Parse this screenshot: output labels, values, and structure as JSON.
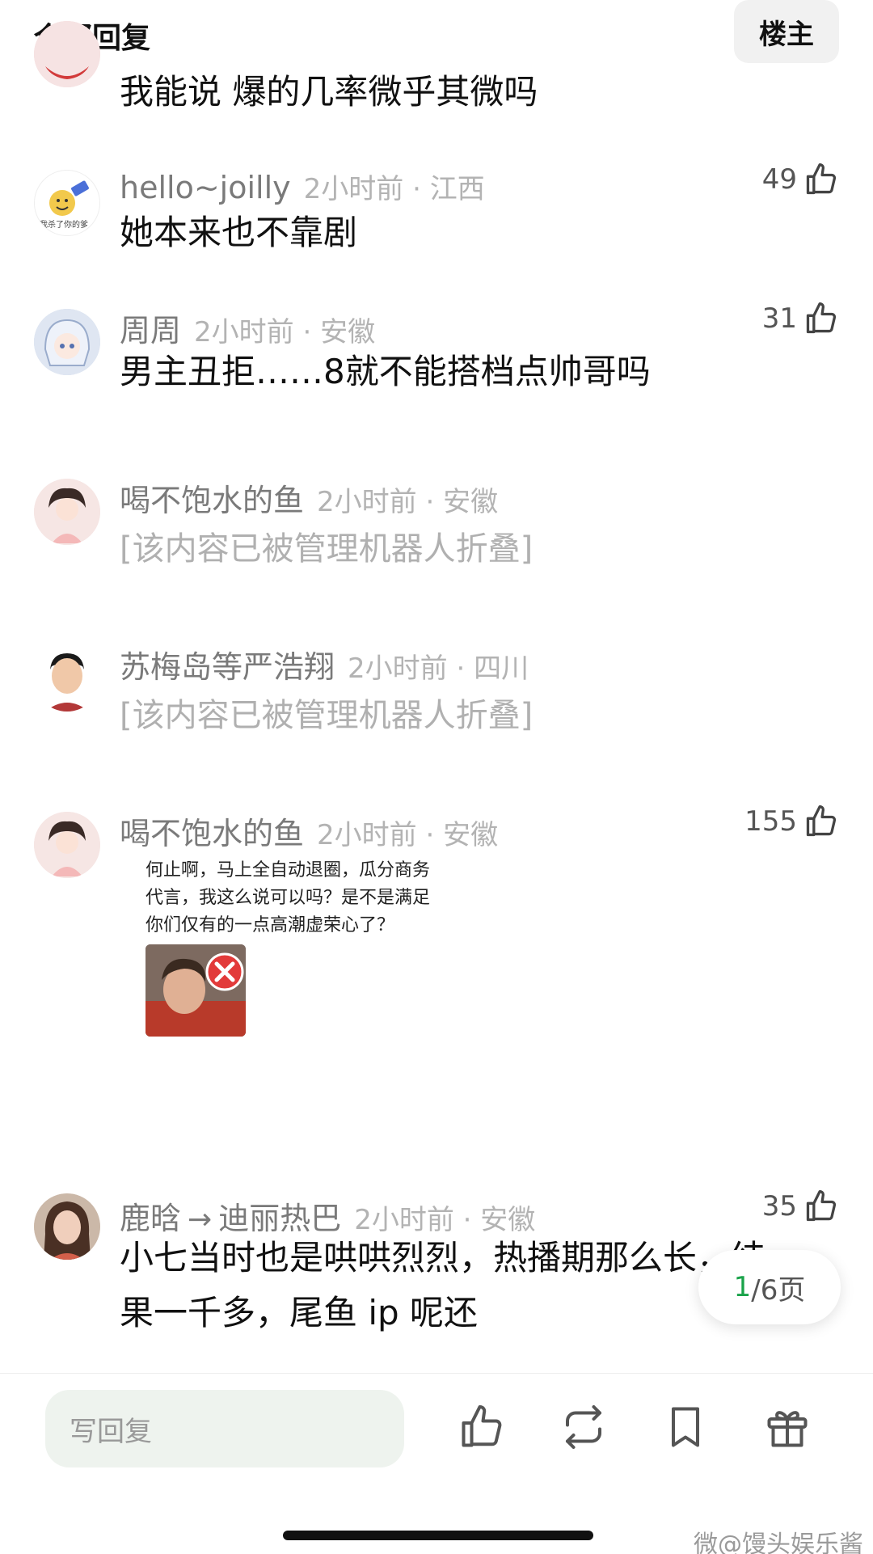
{
  "header": {
    "title": "全部回复",
    "op_button": "楼主"
  },
  "comments": [
    {
      "text": "我能说 爆的几率微乎其微吗"
    },
    {
      "name": "hello~joilly",
      "time": "2小时前 · 江西",
      "likes": "49",
      "text": "她本来也不靠剧",
      "avatar_caption": "我杀了你的爹"
    },
    {
      "name": "周周",
      "time": "2小时前 · 安徽",
      "likes": "31",
      "text": "男主丑拒……8就不能搭档点帅哥吗"
    },
    {
      "name": "喝不饱水的鱼",
      "time": "2小时前 · 安徽",
      "folded": "[该内容已被管理机器人折叠]"
    },
    {
      "name": "苏梅岛等严浩翔",
      "time": "2小时前 · 四川",
      "folded": "[该内容已被管理机器人折叠]"
    },
    {
      "name": "喝不饱水的鱼",
      "time": "2小时前 · 安徽",
      "likes": "155",
      "quote_lines": [
        "何止啊，马上全自动退圈，瓜分商务",
        "代言，我这么说可以吗？是不是满足",
        "你们仅有的一点高潮虚荣心了？"
      ]
    },
    {
      "name": "鹿晗",
      "arrow": "→",
      "reply_to": "迪丽热巴",
      "time": "2小时前 · 安徽",
      "likes": "35",
      "text_line1": "小七当时也是哄哄烈烈，热播期那么长，结",
      "text_line2": "果一千多，尾鱼 ip 呢还"
    }
  ],
  "pager": {
    "current": "1",
    "total": "/6页"
  },
  "bottom_bar": {
    "reply_placeholder": "写回复"
  },
  "watermark": "微@馒头娱乐酱",
  "colors": {
    "accent": "#1aa34a",
    "meta_gray": "#7a7a7a",
    "time_gray": "#b3b3b3"
  }
}
